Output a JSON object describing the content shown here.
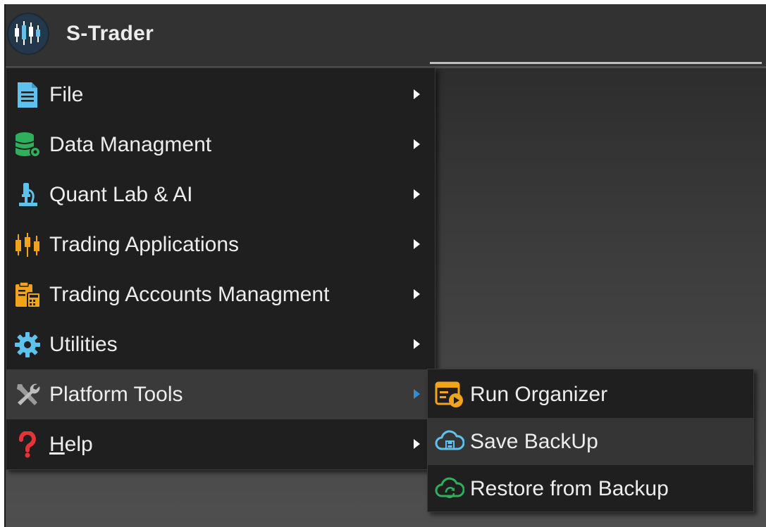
{
  "app": {
    "title": "S-Trader",
    "logo_icon": "candlestick-logo-icon"
  },
  "colors": {
    "titlebar": "#323232",
    "menu_background": "#1f1f1f",
    "menu_active": "#3a3a3a",
    "submenu_hover": "#353535",
    "text": "#ededed",
    "accent_blue": "#2f8fd6",
    "icon_green": "#2fae5c",
    "icon_orange": "#f2a31b",
    "icon_red": "#e5333a",
    "icon_light_blue": "#5fc2ec"
  },
  "menu": {
    "items": [
      {
        "label": "File",
        "icon": "document-icon",
        "has_submenu": true
      },
      {
        "label": "Data Managment",
        "icon": "database-gear-icon",
        "has_submenu": true
      },
      {
        "label": "Quant Lab & AI",
        "icon": "microscope-icon",
        "has_submenu": true
      },
      {
        "label": "Trading Applications",
        "icon": "candlestick-icon",
        "has_submenu": true
      },
      {
        "label": "Trading Accounts Managment",
        "icon": "clipboard-calculator-icon",
        "has_submenu": true
      },
      {
        "label": "Utilities",
        "icon": "gear-icon",
        "has_submenu": true
      },
      {
        "label": "Platform Tools",
        "icon": "tools-icon",
        "has_submenu": true,
        "active": true
      },
      {
        "label": "Help",
        "icon": "question-icon",
        "has_submenu": true,
        "accelerator": "H"
      }
    ]
  },
  "submenu": {
    "parent": "Platform Tools",
    "items": [
      {
        "label": "Run Organizer",
        "icon": "organizer-icon"
      },
      {
        "label": "Save BackUp",
        "icon": "cloud-save-icon",
        "hover": true
      },
      {
        "label": "Restore from Backup",
        "icon": "cloud-restore-icon"
      }
    ]
  }
}
